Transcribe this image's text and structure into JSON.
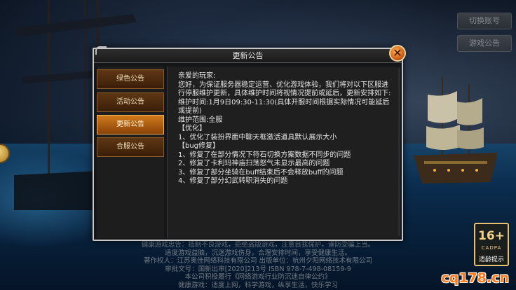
{
  "top_buttons": {
    "switch_account": "切换账号",
    "game_notice": "游戏公告"
  },
  "dialog": {
    "title": "更新公告",
    "close_symbol": "✕",
    "tabs": [
      {
        "label": "绿色公告",
        "active": false
      },
      {
        "label": "活动公告",
        "active": false
      },
      {
        "label": "更新公告",
        "active": true
      },
      {
        "label": "合服公告",
        "active": false
      }
    ],
    "body_lines": [
      "亲爱的玩家:",
      "您好，为保证服务器稳定运营、优化游戏体验，我们将对以下区服进行停服维护更新，具体维护时间将视情况提前或延后，更新安排如下:",
      "维护时间:1月9日09:30-11:30(具体开服时间根据实际情况可能延后或提前)",
      "维护范围:全服",
      "【优化】",
      "1、优化了装扮界面中聊天框激活道具默认展示大小",
      "【bug修复】",
      "1、修复了在部分情况下符石切换方案数据不同步的问题",
      "2、修复了卡利玛神庙扫荡怒气未显示最高的问题",
      "3、修复了部分坐骑在buff结束后不会释放buff的问题",
      "4、修复了部分幻武转职消失的问题"
    ]
  },
  "footer": {
    "lines": [
      "健康游戏忠告：抵制不良游戏，拒绝盗版游戏，注意自我保护，谨防受骗上当。",
      "适度游戏益脑，沉迷游戏伤身，合理安排时间，享受健康生活。",
      "著作权人：江苏奥佳网络科技有限公司   出版单位：杭州夕阳网络技术有限公司",
      "审批文号：国新出审[2020]213号   ISBN 978-7-498-08159-9",
      "本公司积极履行《网络游戏行业防沉迷自律公约》",
      "健康游戏：适度上网，科学游戏，纵享生活，快乐学习"
    ]
  },
  "age_rating": {
    "age": "16+",
    "org": "CADPA",
    "tip": "适龄提示"
  },
  "watermark": "cq178.cn",
  "colors": {
    "tab_active": "#d07a1a",
    "tab_inactive": "#5e3614",
    "close_button": "#d2621a",
    "dialog_border": "#c9c9c9"
  }
}
